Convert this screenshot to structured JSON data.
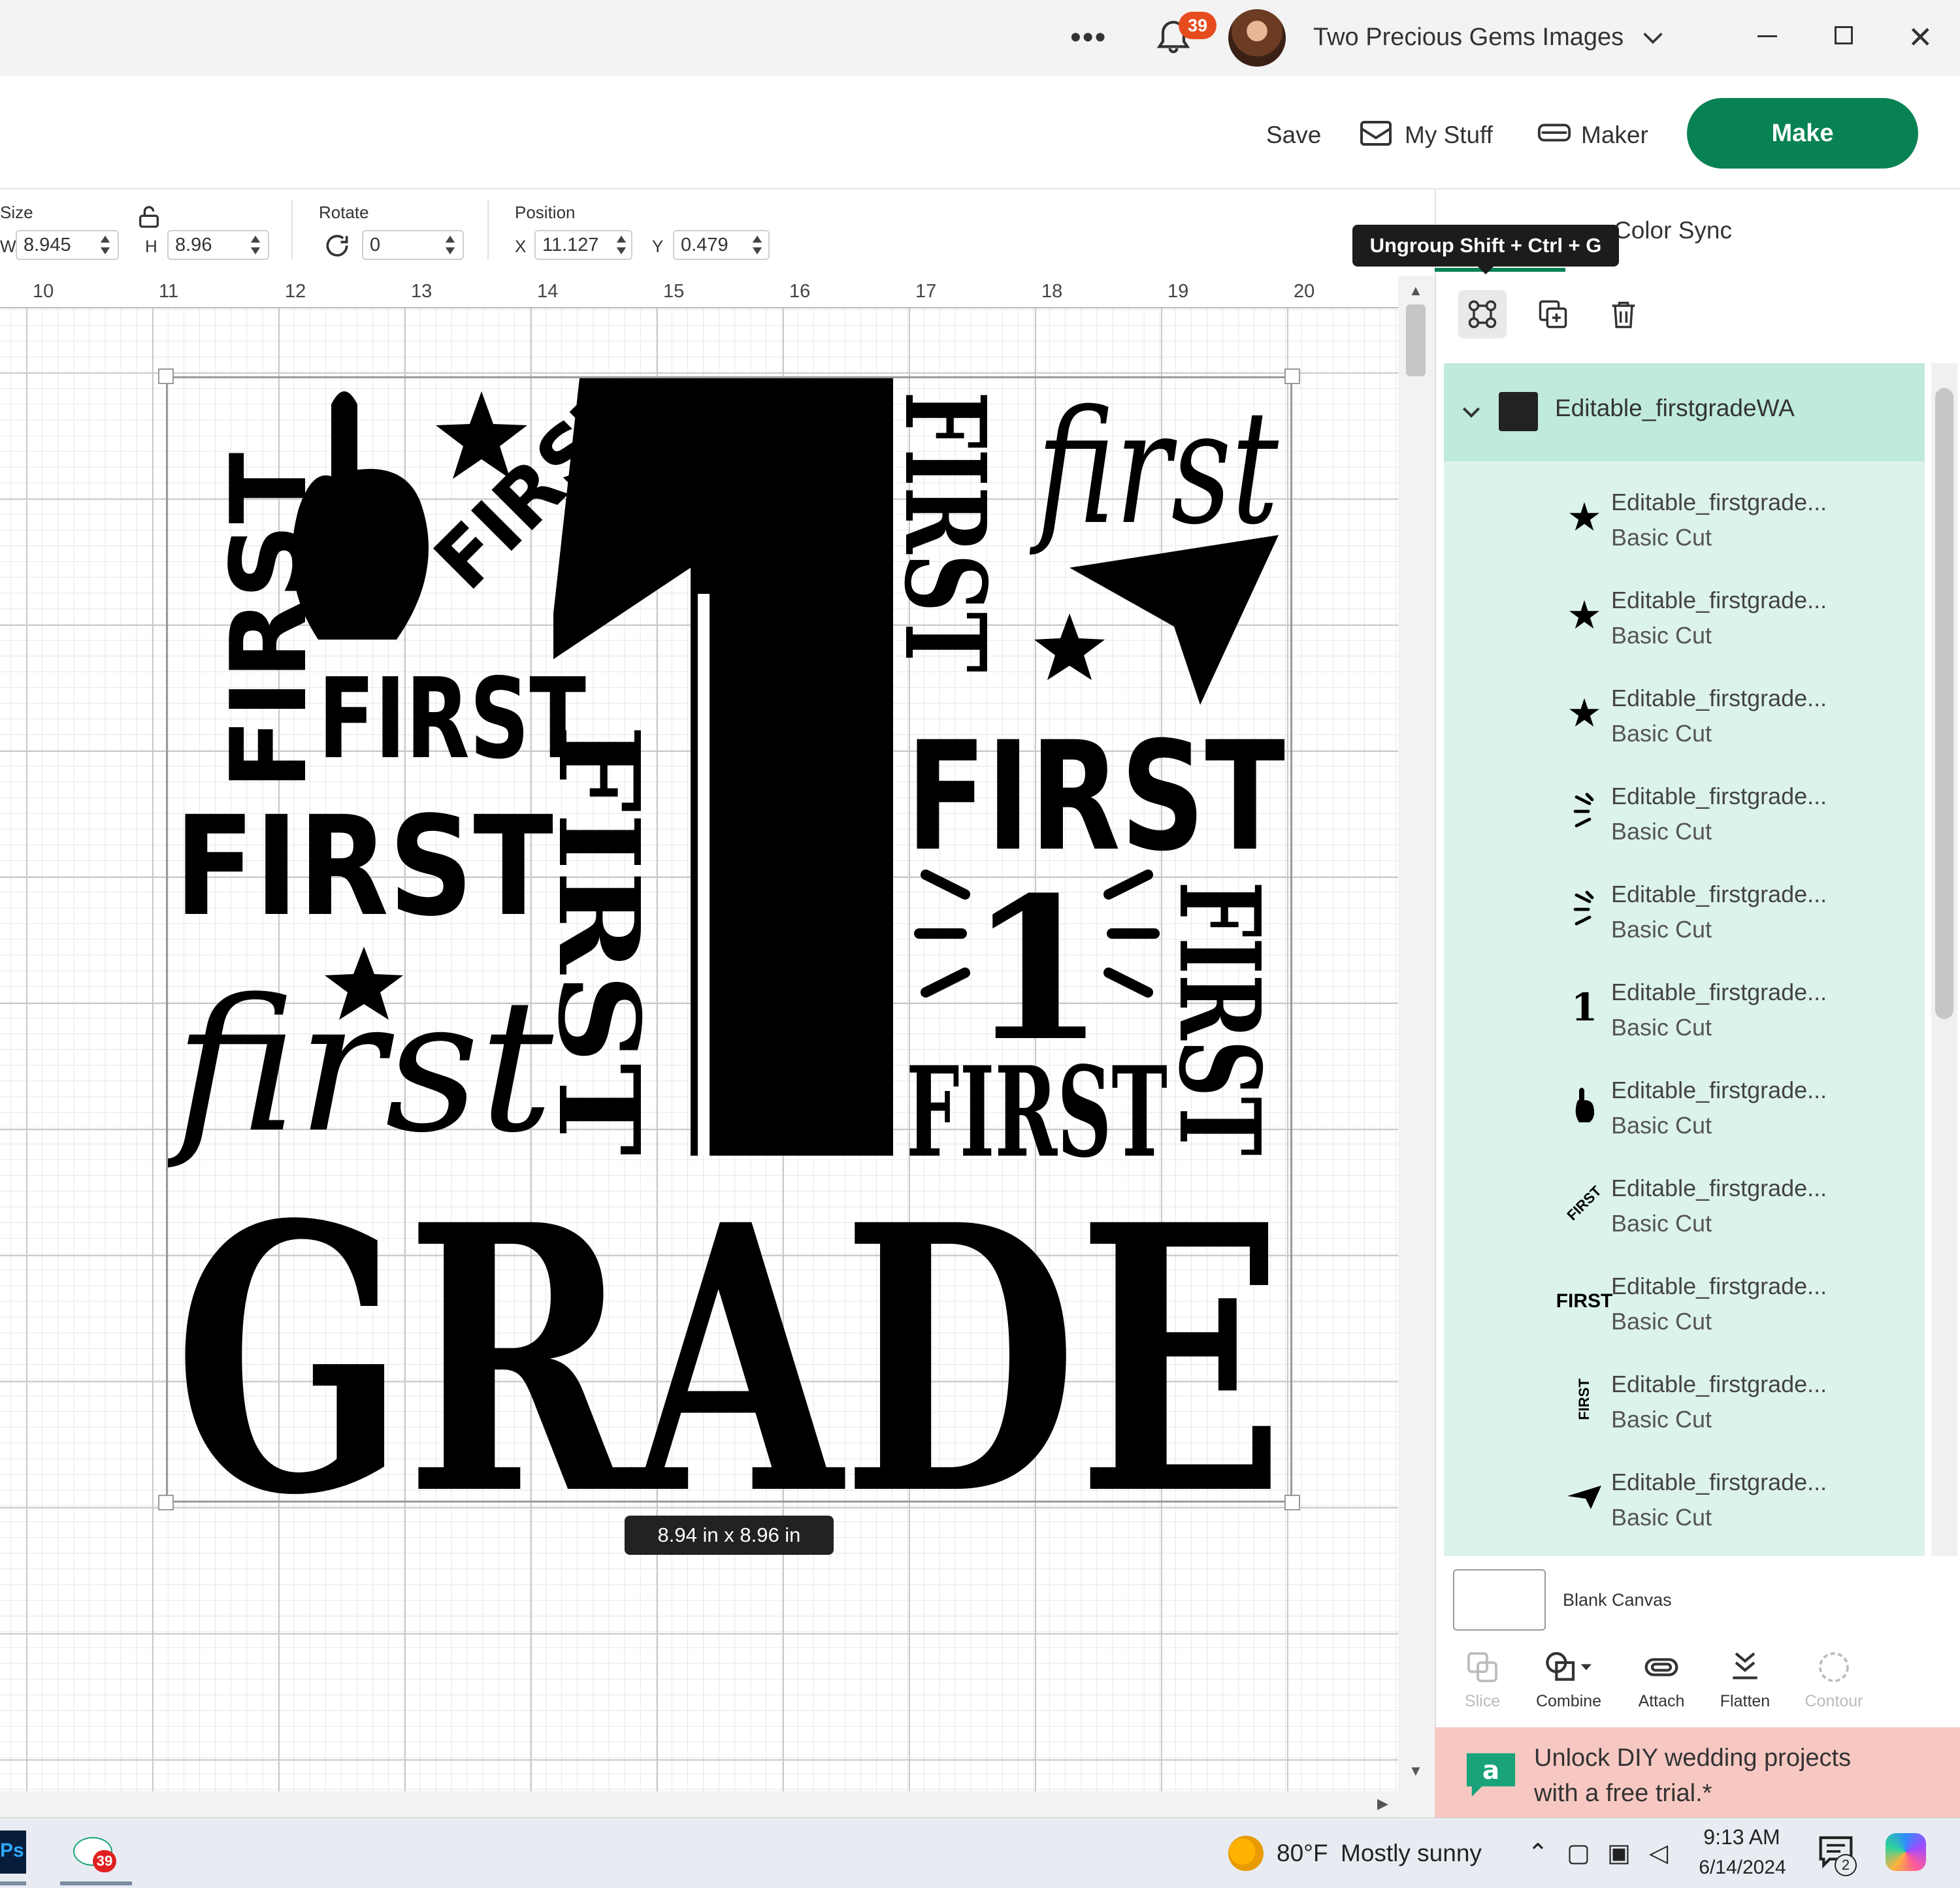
{
  "titlebar": {
    "more_label": "•••",
    "notifications_count": "39",
    "account_name": "Two Precious Gems Images"
  },
  "header": {
    "save_label": "Save",
    "my_stuff_label": "My Stuff",
    "maker_label": "Maker",
    "make_label": "Make",
    "accent_color": "#088253"
  },
  "toolbar": {
    "size_label": "Size",
    "w_label": "W",
    "w_value": "8.945",
    "h_label": "H",
    "h_value": "8.96",
    "rotate_label": "Rotate",
    "rotate_value": "0",
    "position_label": "Position",
    "x_label": "X",
    "x_value": "11.127",
    "y_label": "Y",
    "y_value": "0.479"
  },
  "ruler": [
    "10",
    "11",
    "12",
    "13",
    "14",
    "15",
    "16",
    "17",
    "18",
    "19",
    "20"
  ],
  "design": {
    "grade_text": "GRADE",
    "big_one": "1",
    "size_readout": "8.94  in x 8.96  in",
    "words": {
      "w1": "FIRST",
      "w2": "FIRST",
      "w3": "FIRST",
      "w4": "first",
      "w5": "FIRST",
      "w6": "FIRST",
      "w7": "FIRST",
      "w8": "first",
      "w9": "FIRST",
      "w10": "FIRST",
      "w11": "FIRST",
      "w12": "1"
    }
  },
  "panel": {
    "tab_color_sync": "Color Sync",
    "tooltip": "Ungroup Shift + Ctrl + G",
    "group_name": "Editable_firstgradeWA",
    "layers": [
      {
        "name": "Editable_firstgrade...",
        "type": "Basic Cut",
        "icon": "star-icon"
      },
      {
        "name": "Editable_firstgrade...",
        "type": "Basic Cut",
        "icon": "star-icon"
      },
      {
        "name": "Editable_firstgrade...",
        "type": "Basic Cut",
        "icon": "star-icon"
      },
      {
        "name": "Editable_firstgrade...",
        "type": "Basic Cut",
        "icon": "rays-icon"
      },
      {
        "name": "Editable_firstgrade...",
        "type": "Basic Cut",
        "icon": "rays-icon"
      },
      {
        "name": "Editable_firstgrade...",
        "type": "Basic Cut",
        "icon": "number-one-icon"
      },
      {
        "name": "Editable_firstgrade...",
        "type": "Basic Cut",
        "icon": "pointing-hand-icon"
      },
      {
        "name": "Editable_firstgrade...",
        "type": "Basic Cut",
        "icon": "first-diagonal-text-icon"
      },
      {
        "name": "Editable_firstgrade...",
        "type": "Basic Cut",
        "icon": "first-text-icon"
      },
      {
        "name": "Editable_firstgrade...",
        "type": "Basic Cut",
        "icon": "first-vertical-text-icon"
      },
      {
        "name": "Editable_firstgrade...",
        "type": "Basic Cut",
        "icon": "paper-plane-icon"
      }
    ],
    "layer_icon_glyphs": {
      "star": "★",
      "one": "1",
      "first": "FIRST"
    },
    "blank_canvas_label": "Blank Canvas",
    "tools": {
      "slice": "Slice",
      "combine": "Combine",
      "attach": "Attach",
      "flatten": "Flatten",
      "contour": "Contour"
    },
    "promo_text": "Unlock DIY wedding projects\nwith a free trial.*",
    "promo_color": "#f7c8c2"
  },
  "taskbar": {
    "ps_label": "Ps",
    "cricut_badge": "39",
    "weather_temp": "80°F",
    "weather_desc": "Mostly sunny",
    "time": "9:13 AM",
    "date": "6/14/2024",
    "notif_count": "2"
  }
}
